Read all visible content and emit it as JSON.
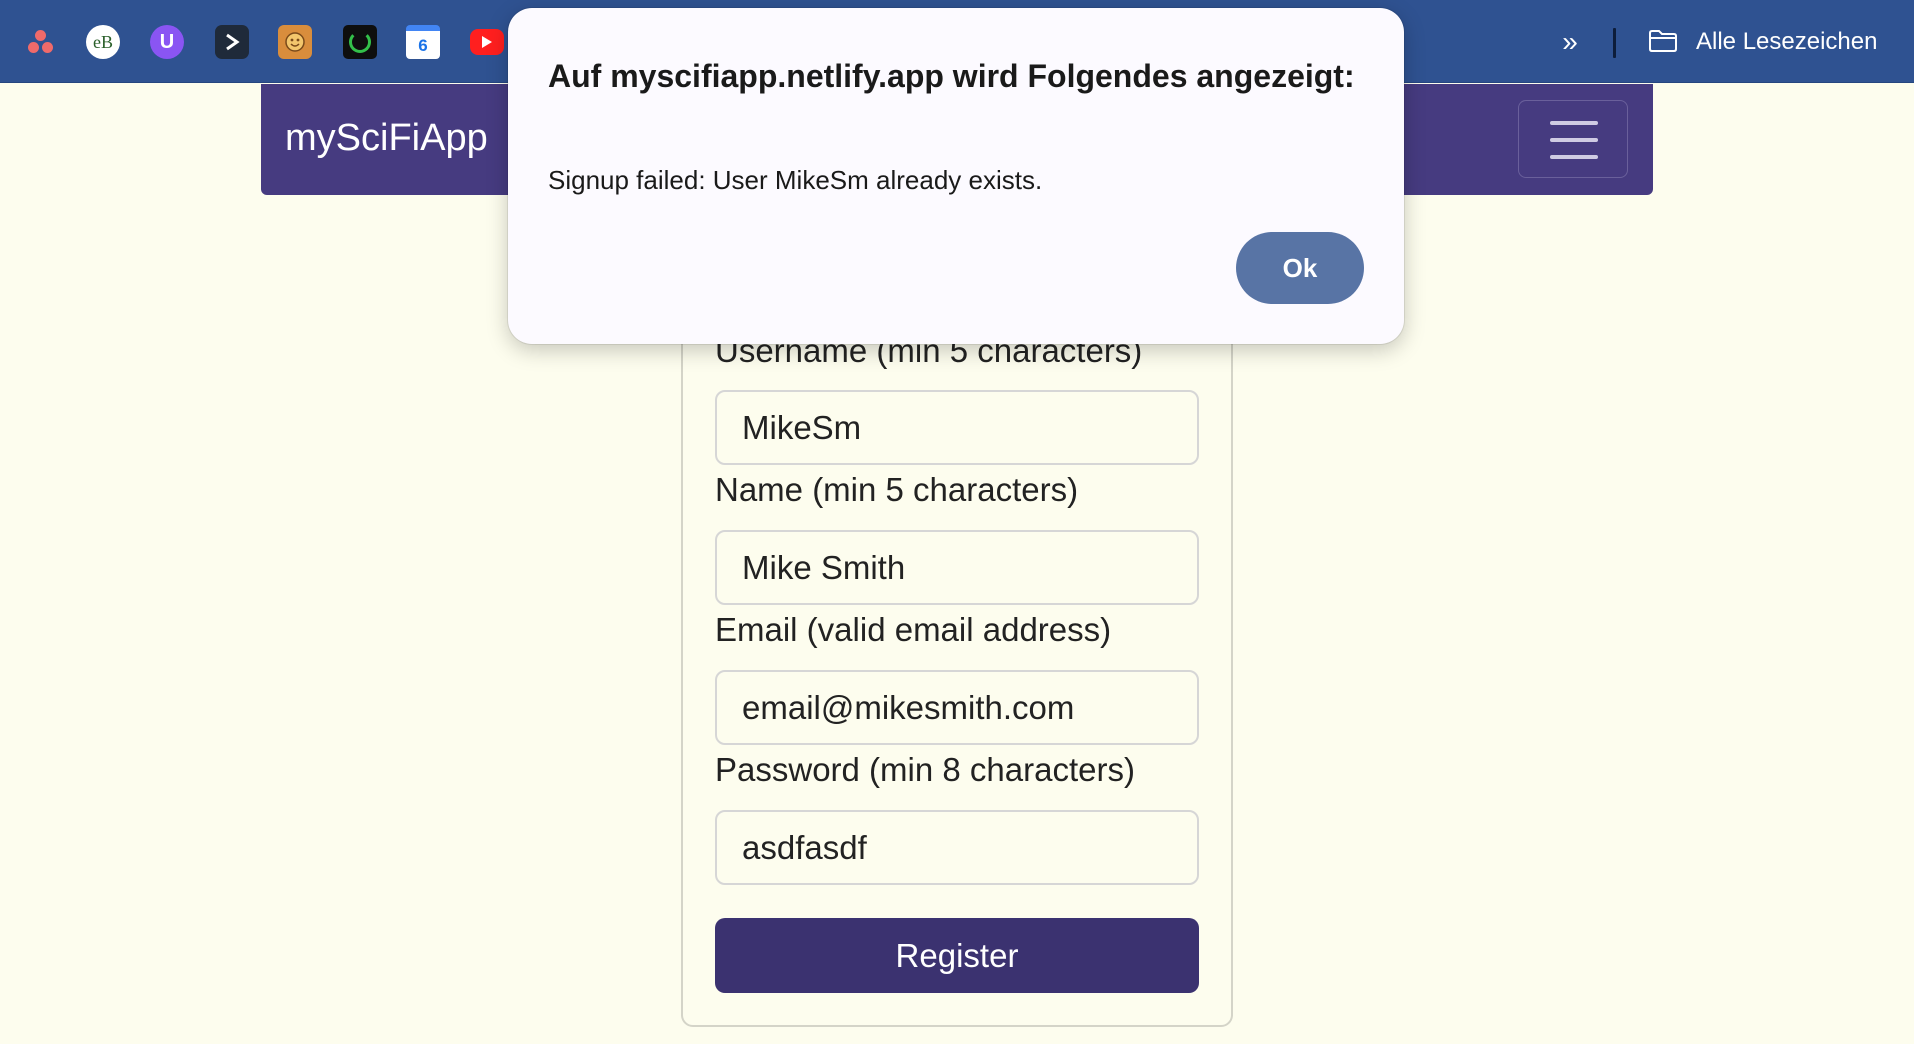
{
  "bookmarks_bar": {
    "icons": [
      "asana-icon",
      "eb-icon",
      "u-icon",
      "play-icon",
      "face-icon",
      "ring-icon",
      "calendar-icon",
      "youtube-icon"
    ],
    "calendar_day": "6",
    "eb_text": "eB",
    "u_text": "U",
    "chevrons": "»",
    "all_bookmarks_label": "Alle Lesezeichen"
  },
  "navbar": {
    "brand": "mySciFiApp"
  },
  "form": {
    "username": {
      "label": "Username (min 5 characters)",
      "value": "MikeSm"
    },
    "name": {
      "label": "Name (min 5 characters)",
      "value": "Mike Smith"
    },
    "email": {
      "label": "Email (valid email address)",
      "value": "email@mikesmith.com"
    },
    "password": {
      "label": "Password (min 8 characters)",
      "value": "asdfasdf"
    },
    "register_label": "Register"
  },
  "dialog": {
    "title": "Auf myscifiapp.netlify.app wird Folgendes angezeigt:",
    "message": "Signup failed: User MikeSm already exists.",
    "ok_label": "Ok"
  },
  "colors": {
    "bookmarks_bg": "#2f5291",
    "navbar_bg": "#463b80",
    "page_bg": "#fdfdee",
    "register_bg": "#3b3270",
    "ok_bg": "#5874a5"
  }
}
